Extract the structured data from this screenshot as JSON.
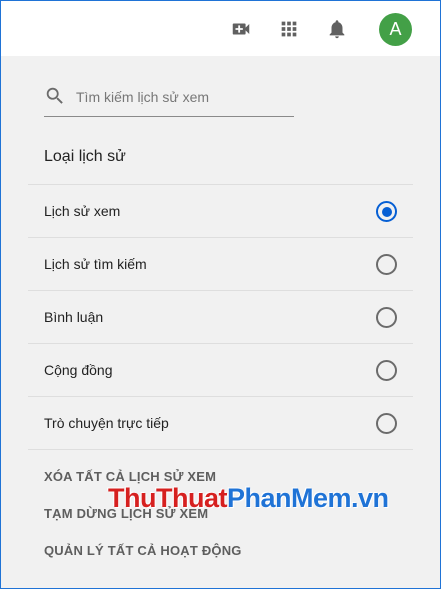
{
  "header": {
    "icons": [
      "create-video-icon",
      "apps-grid-icon",
      "notifications-bell-icon"
    ],
    "avatar_letter": "A",
    "avatar_color": "#43a047"
  },
  "search": {
    "placeholder": "Tìm kiếm lịch sử xem",
    "value": ""
  },
  "history_type": {
    "title": "Loại lịch sử",
    "options": [
      {
        "label": "Lịch sử xem",
        "selected": true
      },
      {
        "label": "Lịch sử tìm kiếm",
        "selected": false
      },
      {
        "label": "Bình luận",
        "selected": false
      },
      {
        "label": "Cộng đồng",
        "selected": false
      },
      {
        "label": "Trò chuyện trực tiếp",
        "selected": false
      }
    ]
  },
  "actions": {
    "clear_all": "XÓA TẤT CẢ LỊCH SỬ XEM",
    "pause": "TẠM DỪNG LỊCH SỬ XEM",
    "manage": "QUẢN LÝ TẤT CẢ HOẠT ĐỘNG"
  },
  "watermark": {
    "part1": "ThuThuat",
    "part2": "PhanMem",
    "part3": ".vn",
    "color_red": "#d6201f",
    "color_blue": "#1f73d6"
  },
  "colors": {
    "accent": "#065fd4",
    "panel_bg": "#f1f1f1"
  }
}
